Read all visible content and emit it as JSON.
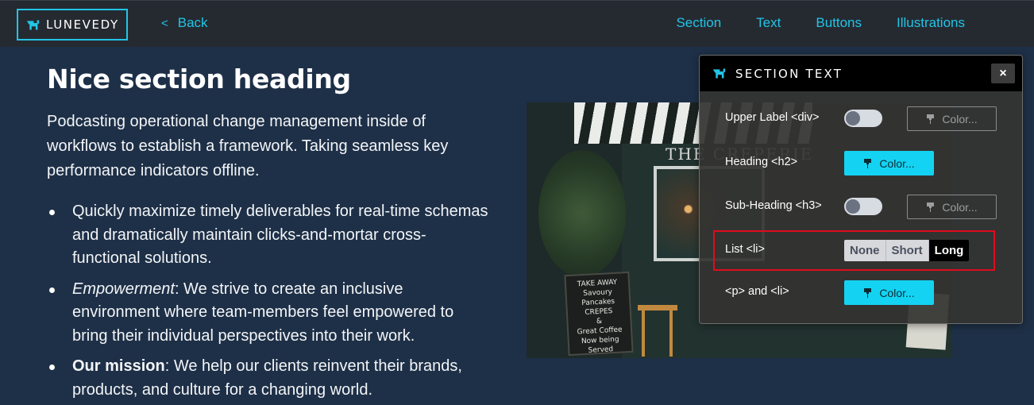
{
  "brand": {
    "name": "LUNEVEDY",
    "icon": "dog-icon",
    "accent": "#22c4e6"
  },
  "topbar": {
    "back_chevron": "<",
    "back_label": "Back",
    "nav": [
      "Section",
      "Text",
      "Buttons",
      "Illustrations"
    ]
  },
  "content": {
    "heading": "Nice section heading",
    "intro": "Podcasting operational change management inside of workflows to establish a framework. Taking seamless key performance indicators offline.",
    "bullets": [
      {
        "lead": "",
        "text": "Quickly maximize timely deliverables for real-time schemas and dramatically maintain clicks-and-mortar cross-functional solutions."
      },
      {
        "lead": "Empowerment",
        "text": ": We strive to create an inclusive environment where team-members feel empowered to bring their individual perspectives into their work."
      },
      {
        "lead": "Our mission",
        "text": ": We help our clients reinvent their brands, products, and culture for a changing world."
      }
    ],
    "photo": {
      "sign": "THE CREPERIE",
      "chalkboard": [
        "TAKE AWAY",
        "Savoury Pancakes",
        "CREPES",
        "&",
        "Great Coffee",
        "Now being Served"
      ]
    }
  },
  "panel": {
    "title": "SECTION TEXT",
    "close_label": "×",
    "rows": {
      "upper_label": {
        "label": "Upper Label <div>",
        "color_label": "Color..."
      },
      "heading": {
        "label": "Heading <h2>",
        "color_label": "Color..."
      },
      "sub_heading": {
        "label": "Sub-Heading <h3>",
        "color_label": "Color..."
      },
      "list": {
        "label": "List <li>",
        "options": [
          "None",
          "Short",
          "Long"
        ],
        "selected": "Long"
      },
      "p_and_li": {
        "label": "<p> and <li>",
        "color_label": "Color..."
      }
    },
    "colors": {
      "active_button": "#14d3f2",
      "highlight": "#e00b1c"
    }
  }
}
